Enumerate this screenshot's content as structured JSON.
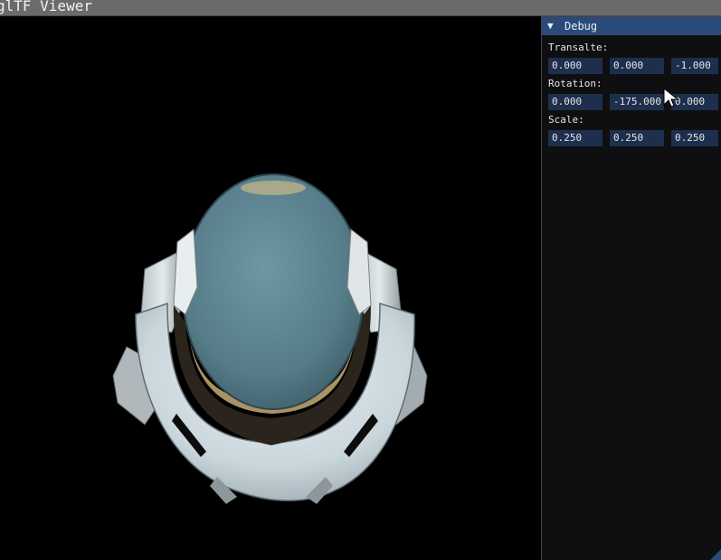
{
  "window": {
    "title": "glTF Viewer"
  },
  "debug": {
    "header": "Debug",
    "collapse_icon": "triangle-down-icon",
    "translate": {
      "label": "Transalte:",
      "values": [
        "0.000",
        "0.000",
        "-1.000"
      ]
    },
    "rotation": {
      "label": "Rotation:",
      "values": [
        "0.000",
        "-175.000",
        "0.000"
      ]
    },
    "scale": {
      "label": "Scale:",
      "values": [
        "0.250",
        "0.250",
        "0.250"
      ]
    }
  },
  "viewport": {
    "model": "helmet-model",
    "background_color": "#000000"
  },
  "colors": {
    "header_accent": "#2a4a7a",
    "input_bg": "#1d2f4d",
    "panel_bg": "#0f0f12"
  }
}
